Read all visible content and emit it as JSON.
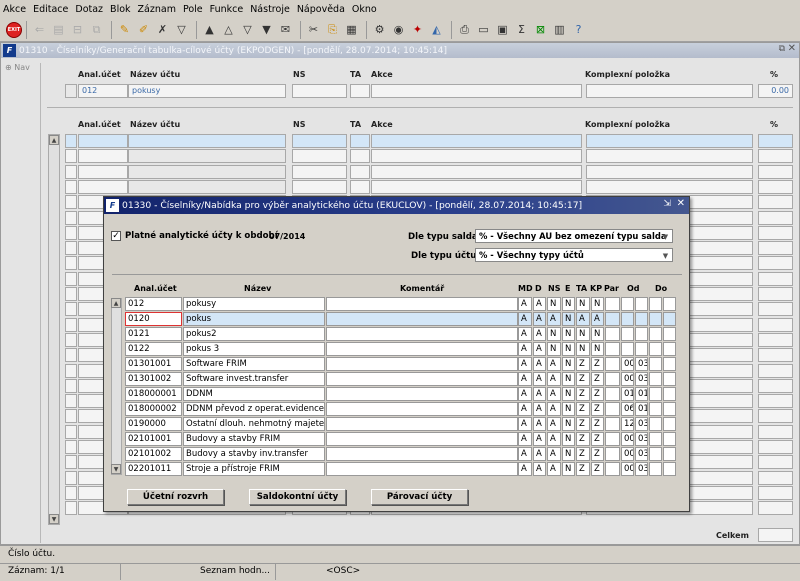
{
  "menu": [
    "Akce",
    "Editace",
    "Dotaz",
    "Blok",
    "Záznam",
    "Pole",
    "Funkce",
    "Nástroje",
    "Nápověda",
    "Okno"
  ],
  "main": {
    "title": "01310 - Číselníky/Generační tabulka-cílové účty (EKPODGEN) - [pondělí, 28.07.2014; 10:45:14]",
    "nav": "Nav",
    "headers": {
      "anal": "Anal.účet",
      "nazev": "Název účtu",
      "ns": "NS",
      "ta": "TA",
      "akce": "Akce",
      "komplex": "Komplexní položka",
      "pct": "%"
    },
    "top_row": {
      "anal": "012",
      "nazev": "pokusy",
      "pct": "0.00"
    },
    "celkem": "Celkem"
  },
  "dialog": {
    "title": "01330 - Číselníky/Nabídka pro výběr analytického účtu (EKUCLOV) - [pondělí, 28.07.2014; 10:45:17]",
    "platne_label": "Platné analytické účty k období",
    "platne_checked": "✓",
    "obdobi": "07/2014",
    "saldo_label": "Dle typu salda",
    "saldo_value": "% - Všechny AU bez omezení typu salda",
    "typ_label": "Dle typu účtu",
    "typ_value": "% - Všechny typy účtů",
    "cols": {
      "anal": "Anal.účet",
      "nazev": "Název",
      "komentar": "Komentář",
      "md": "MD",
      "d": "D",
      "ns": "NS",
      "e": "E",
      "ta": "TA",
      "kp": "KP",
      "par": "Par",
      "od": "Od",
      "do": "Do"
    },
    "rows": [
      {
        "anal": "012",
        "nazev": "pokusy",
        "md": "A",
        "d": "A",
        "ns": "N",
        "e": "N",
        "ta": "N",
        "kp": "N",
        "od1": "",
        "od2": ""
      },
      {
        "anal": "0120",
        "nazev": "pokus",
        "md": "A",
        "d": "A",
        "ns": "A",
        "e": "N",
        "ta": "A",
        "kp": "A",
        "od1": "",
        "od2": ""
      },
      {
        "anal": "0121",
        "nazev": "pokus2",
        "md": "A",
        "d": "A",
        "ns": "N",
        "e": "N",
        "ta": "N",
        "kp": "N",
        "od1": "",
        "od2": ""
      },
      {
        "anal": "0122",
        "nazev": "pokus 3",
        "md": "A",
        "d": "A",
        "ns": "N",
        "e": "N",
        "ta": "N",
        "kp": "N",
        "od1": "",
        "od2": ""
      },
      {
        "anal": "01301001",
        "nazev": "Software FRIM",
        "md": "A",
        "d": "A",
        "ns": "A",
        "e": "N",
        "ta": "Z",
        "kp": "Z",
        "od1": "00",
        "od2": "03"
      },
      {
        "anal": "01301002",
        "nazev": "Software invest.transfer",
        "md": "A",
        "d": "A",
        "ns": "A",
        "e": "N",
        "ta": "Z",
        "kp": "Z",
        "od1": "00",
        "od2": "03"
      },
      {
        "anal": "018000001",
        "nazev": "DDNM",
        "md": "A",
        "d": "A",
        "ns": "A",
        "e": "N",
        "ta": "Z",
        "kp": "Z",
        "od1": "01",
        "od2": "01"
      },
      {
        "anal": "018000002",
        "nazev": "DDNM převod z operat.evidence",
        "md": "A",
        "d": "A",
        "ns": "A",
        "e": "N",
        "ta": "Z",
        "kp": "Z",
        "od1": "06",
        "od2": "01"
      },
      {
        "anal": "0190000",
        "nazev": "Ostatní dlouh. nehmotný majete",
        "md": "A",
        "d": "A",
        "ns": "A",
        "e": "N",
        "ta": "Z",
        "kp": "Z",
        "od1": "12",
        "od2": "03"
      },
      {
        "anal": "02101001",
        "nazev": "Budovy a stavby FRIM",
        "md": "A",
        "d": "A",
        "ns": "A",
        "e": "N",
        "ta": "Z",
        "kp": "Z",
        "od1": "00",
        "od2": "03"
      },
      {
        "anal": "02101002",
        "nazev": "Budovy a stavby inv.transfer",
        "md": "A",
        "d": "A",
        "ns": "A",
        "e": "N",
        "ta": "Z",
        "kp": "Z",
        "od1": "00",
        "od2": "03"
      },
      {
        "anal": "02201011",
        "nazev": "Stroje a přístroje FRIM",
        "md": "A",
        "d": "A",
        "ns": "A",
        "e": "N",
        "ta": "Z",
        "kp": "Z",
        "od1": "00",
        "od2": "03"
      }
    ],
    "buttons": [
      "Účetní rozvrh",
      "Saldokontní účty",
      "Párovací účty"
    ]
  },
  "status": {
    "field": "Číslo účtu.",
    "record": "Záznam: 1/1",
    "seznam": "Seznam hodn...",
    "osc": "<OSC>"
  }
}
